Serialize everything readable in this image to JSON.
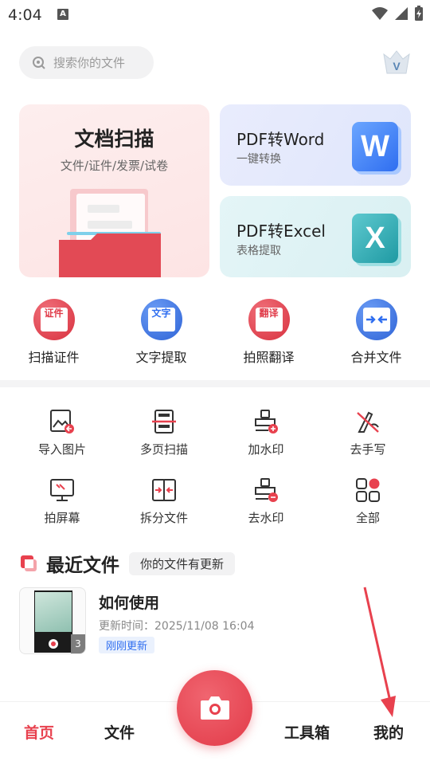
{
  "status_bar": {
    "time": "4:04",
    "notification_letter": "A"
  },
  "header": {
    "search_placeholder": "搜索你的文件",
    "vip_letter": "V"
  },
  "feature_cards": {
    "scan": {
      "title": "文档扫描",
      "subtitle": "文件/证件/发票/试卷"
    },
    "pdf_word": {
      "title": "PDF转Word",
      "subtitle": "一键转换",
      "icon_letter": "W"
    },
    "pdf_excel": {
      "title": "PDF转Excel",
      "subtitle": "表格提取",
      "icon_letter": "X"
    }
  },
  "quick_actions": [
    {
      "label": "扫描证件",
      "icon_text": "证件",
      "icon": "id-card-icon",
      "color": "#e03a48"
    },
    {
      "label": "文字提取",
      "icon_text": "文字",
      "icon": "text-extract-icon",
      "color": "#2f6ef0"
    },
    {
      "label": "拍照翻译",
      "icon_text": "翻译",
      "icon": "translate-icon",
      "color": "#e03a48"
    },
    {
      "label": "合并文件",
      "icon_text": "",
      "icon": "merge-icon",
      "color": "#2f6ef0"
    }
  ],
  "tools": [
    {
      "label": "导入图片",
      "icon": "import-image-icon"
    },
    {
      "label": "多页扫描",
      "icon": "multi-page-scan-icon"
    },
    {
      "label": "加水印",
      "icon": "add-watermark-icon"
    },
    {
      "label": "去手写",
      "icon": "remove-handwriting-icon"
    },
    {
      "label": "拍屏幕",
      "icon": "screen-capture-icon"
    },
    {
      "label": "拆分文件",
      "icon": "split-file-icon"
    },
    {
      "label": "去水印",
      "icon": "remove-watermark-icon"
    },
    {
      "label": "全部",
      "icon": "all-tools-icon"
    }
  ],
  "recent": {
    "title": "最近文件",
    "badge": "你的文件有更新",
    "files": [
      {
        "name": "如何使用",
        "updated": "更新时间：2025/11/08 16:04",
        "tag": "刚刚更新",
        "page_count": "3"
      }
    ]
  },
  "bottom_nav": {
    "home": "首页",
    "files": "文件",
    "toolbox": "工具箱",
    "mine": "我的"
  },
  "colors": {
    "accent": "#e8414e",
    "blue": "#2f6ef0"
  }
}
